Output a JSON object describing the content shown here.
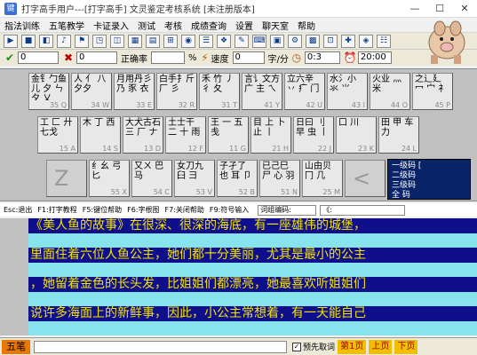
{
  "window": {
    "title": "打字高手用户---[打字高手]    文灵鉴定考核系统 [未注册版本]",
    "minimize": "—",
    "maximize": "☐",
    "close": "✕"
  },
  "menu": [
    "指法训练",
    "五笔教学",
    "卡证录入",
    "测试",
    "考核",
    "成绩查询",
    "设置",
    "聊天室",
    "帮助"
  ],
  "toolbar": {
    "buttons": [
      "▶",
      "■",
      "◧",
      "♪",
      "⚑",
      "◳",
      "◫",
      "▦",
      "▤",
      "⊞",
      "◉",
      "☰",
      "❖",
      "✎",
      "⌨",
      "▣",
      "⚙",
      "▩",
      "⊡",
      "✚",
      "◈",
      "☷"
    ]
  },
  "stats": {
    "correct_icon": "✔",
    "correct_value": "0",
    "wrong_icon": "✖",
    "wrong_value": "0",
    "accuracy_label": "正确率",
    "accuracy_value": "",
    "percent": "%",
    "speed_label": "速度",
    "speed_value": "0",
    "speed_unit": "字/分",
    "elapsed_value": "0:3",
    "limit_value": "20:00"
  },
  "keyboard": {
    "row1": [
      {
        "roots": "金钅勹鱼儿 夕 ㄣ 夕 乂",
        "code": "35 Q"
      },
      {
        "roots": "人 亻 八 夕夕",
        "code": "34 W"
      },
      {
        "roots": "月用丹彡 乃 豕 衣",
        "code": "33 E"
      },
      {
        "roots": "白手扌斤 厂 彡",
        "code": "32 R"
      },
      {
        "roots": "禾 竹 丿 彳 夂",
        "code": "31 T"
      },
      {
        "roots": "言讠文方 广 主 ㄟ",
        "code": "41 Y"
      },
      {
        "roots": "立六辛 丷 疒 门",
        "code": "42 U"
      },
      {
        "roots": "水氵小 氺 ⺌",
        "code": "43 I"
      },
      {
        "roots": "火业 灬 米",
        "code": "44 O"
      },
      {
        "roots": "之辶廴 冖 宀 礻",
        "code": "45 P"
      }
    ],
    "row2": [
      {
        "roots": "工 匚 廾 七戈",
        "code": "15 A"
      },
      {
        "roots": "木 丁 西",
        "code": "14 S"
      },
      {
        "roots": "大犬古石 三 厂 ナ",
        "code": "13 D"
      },
      {
        "roots": "土士干 二 十 雨",
        "code": "12 F"
      },
      {
        "roots": "王 一 五 戋",
        "code": "11 G"
      },
      {
        "roots": "目 上 卜 止 丨",
        "code": "21 H"
      },
      {
        "roots": "日曰 刂 早 虫 丨",
        "code": "22 J"
      },
      {
        "roots": "口 川",
        "code": "23 K"
      },
      {
        "roots": "田 甲 车 力",
        "code": "24 L"
      }
    ],
    "row3": [
      {
        "roots": "Z",
        "code": ""
      },
      {
        "roots": "纟幺 弓 匕",
        "code": "55 X"
      },
      {
        "roots": "又ㄨ 巴 马",
        "code": "54 C"
      },
      {
        "roots": "女刀九 臼 彐",
        "code": "53 V"
      },
      {
        "roots": "子孑了 也 耳 卩",
        "code": "52 B"
      },
      {
        "roots": "已己巳 尸 心 羽",
        "code": "51 N"
      },
      {
        "roots": "山由贝 冂 几",
        "code": "25 M"
      },
      {
        "roots": "<",
        "code": ""
      }
    ],
    "levels": [
      "一级码 [",
      "二级码",
      "三级码",
      "全  码"
    ]
  },
  "hints": {
    "esc": "Esc:退出",
    "f1": "F1:打字教程",
    "f5": "F5:键位帮助",
    "f6": "F6:字根图",
    "f7": "F7:关闭帮助",
    "f9": "F9:符号输入",
    "code_label": "词组编码:",
    "code_value": "《:"
  },
  "text_lines": [
    "《美人鱼的故事》在很深、很深的海底，有一座雄伟的城堡，",
    "里面住着六位人鱼公主，她们都十分美丽，尤其是最小的公主",
    "，她留着金色的长头发，比姐姐们都漂亮，她最喜欢听姐姐们",
    "说许多海面上的新鲜事，因此，小公主常想着，有一天能自己"
  ],
  "bottom": {
    "ime": "五笔",
    "check_label": "预先取词",
    "check_mark": "✓",
    "page_current": "第1页",
    "prev": "上页",
    "next": "下页"
  },
  "colors": {
    "text_bg": "#0f0f8c",
    "text_fg": "#f4e200",
    "input_bg": "#88e4ec",
    "level_bg": "#0a246a",
    "ime_bg": "#e87800"
  }
}
